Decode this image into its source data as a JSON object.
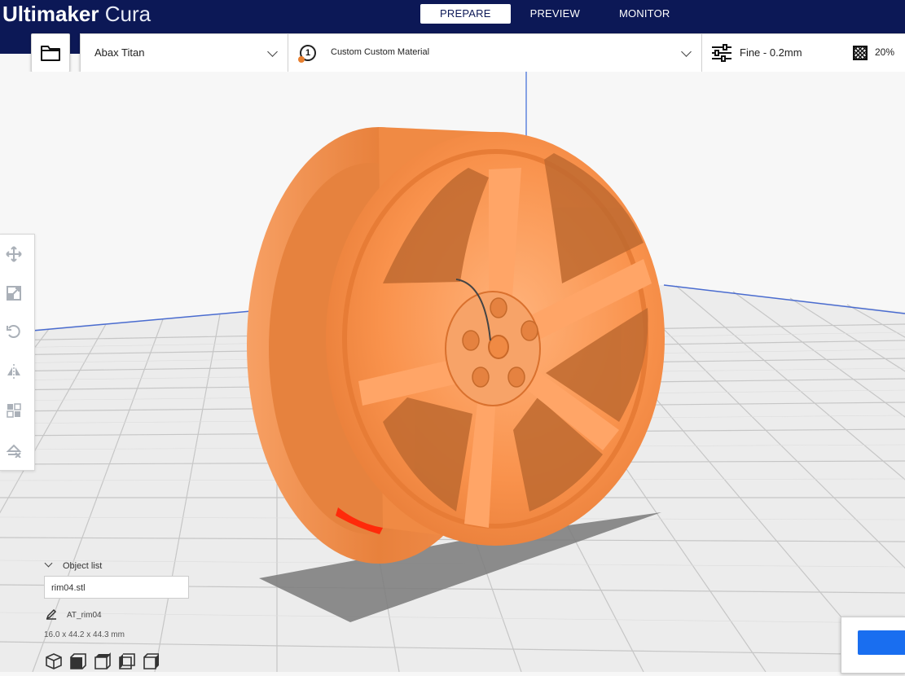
{
  "app": {
    "name_bold": "Ultimaker",
    "name_light": "Cura"
  },
  "stages": [
    {
      "label": "PREPARE",
      "active": true
    },
    {
      "label": "PREVIEW",
      "active": false
    },
    {
      "label": "MONITOR",
      "active": false
    }
  ],
  "printer": {
    "name": "Abax Titan"
  },
  "material": {
    "extruder_number": "1",
    "name": "Custom Custom Material",
    "color": "#e87f2f"
  },
  "print_settings": {
    "profile": "Fine - 0.2mm",
    "infill": "20%"
  },
  "tools": [
    {
      "name": "move-icon"
    },
    {
      "name": "scale-icon"
    },
    {
      "name": "rotate-icon"
    },
    {
      "name": "mirror-icon"
    },
    {
      "name": "per-model-settings-icon"
    },
    {
      "name": "support-blocker-icon"
    }
  ],
  "object_list": {
    "header": "Object list",
    "file": "rim04.stl",
    "object_name": "AT_rim04",
    "dimensions": "16.0 x 44.2 x 44.3 mm"
  },
  "colors": {
    "header_bg": "#0c1856",
    "model": "#f9924c",
    "overhang": "#ff2200",
    "slice_button": "#196ef0"
  }
}
